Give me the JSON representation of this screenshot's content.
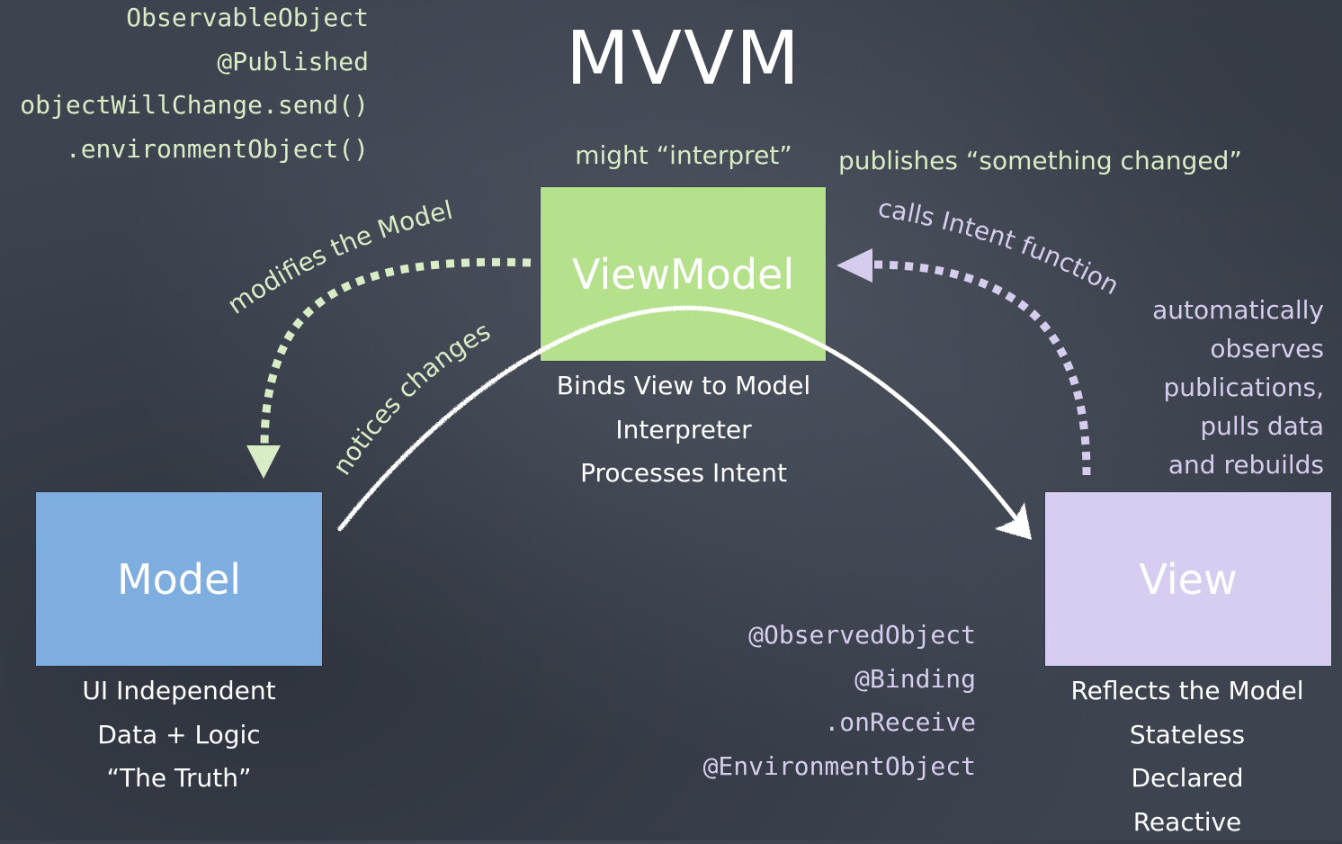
{
  "title": "MVVM",
  "colors": {
    "background": "#3d434f",
    "model": "#7eaddf",
    "viewmodel": "#b5e08c",
    "view": "#d7cdf0",
    "green_text": "#d8ecc6",
    "purple_text": "#d6cdee",
    "chalk_white": "#ffffff"
  },
  "viewmodel_code": [
    "ObservableObject",
    "@Published",
    "objectWillChange.send()",
    ".environmentObject()"
  ],
  "view_code": [
    "@ObservedObject",
    "@Binding",
    ".onReceive",
    "@EnvironmentObject"
  ],
  "boxes": {
    "model": {
      "label": "Model",
      "description": [
        "UI Independent",
        "Data + Logic",
        "“The Truth”"
      ]
    },
    "viewmodel": {
      "label": "ViewModel",
      "description": [
        "Binds View to Model",
        "Interpreter",
        "Processes Intent"
      ]
    },
    "view": {
      "label": "View",
      "description": [
        "Reflects the Model",
        "Stateless",
        "Declared",
        "Reactive"
      ]
    }
  },
  "notes": {
    "might_interpret": "might “interpret”",
    "publishes": "publishes “something changed”",
    "observes": [
      "automatically",
      "observes",
      "publications,",
      "pulls data",
      "and rebuilds"
    ]
  },
  "arrows": {
    "modifies_model": "modifies the Model",
    "notices_changes": "notices changes",
    "calls_intent": "calls Intent function"
  }
}
